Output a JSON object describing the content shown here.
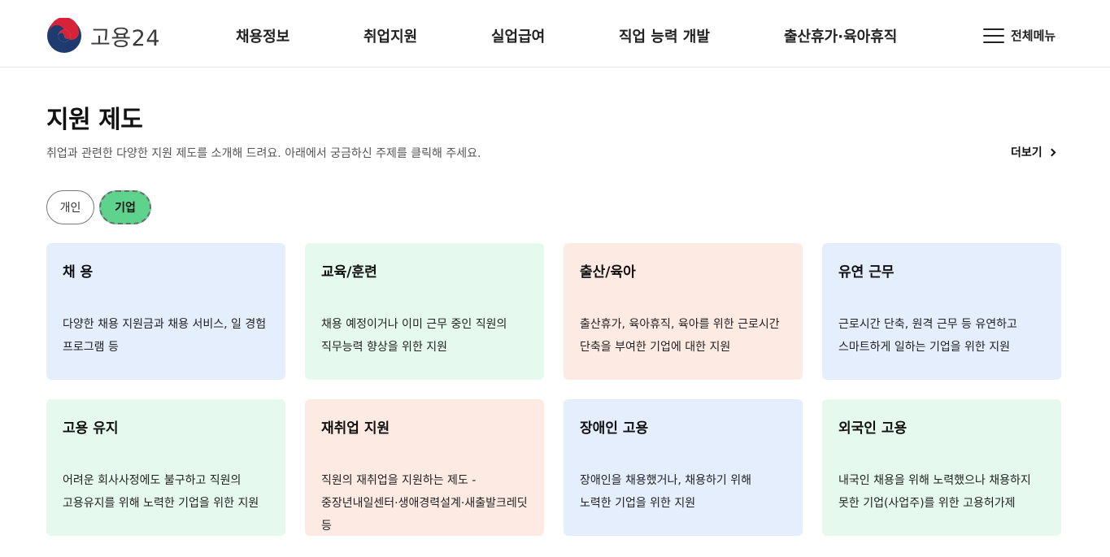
{
  "header": {
    "logo_text": "고용24",
    "nav": [
      "채용정보",
      "취업지원",
      "실업급여",
      "직업 능력 개발",
      "출산휴가·육아휴직"
    ],
    "all_menu_label": "전체메뉴"
  },
  "section": {
    "title": "지원 제도",
    "description": "취업과 관련한 다양한 지원 제도를 소개해 드려요. 아래에서 궁금하신 주제를 클릭해 주세요.",
    "more_label": "더보기"
  },
  "tabs": [
    {
      "label": "개인",
      "selected": false
    },
    {
      "label": "기업",
      "selected": true
    }
  ],
  "colors": {
    "card_blue": "#e4eefd",
    "card_green": "#e5f9ee",
    "card_peach": "#fdebe3",
    "tab_selected": "#5fd38e",
    "logo_blue": "#1e3a6e",
    "logo_red": "#d6233a"
  },
  "cards": [
    {
      "title": "채 용",
      "desc": "다양한 채용 지원금과 채용 서비스, 일 경험 프로그램 등",
      "color": "blue"
    },
    {
      "title": "교육/훈련",
      "desc": "채용 예정이거나 이미 근무 중인 직원의 직무능력 향상을 위한 지원",
      "color": "green"
    },
    {
      "title": "출산/육아",
      "desc": "출산휴가, 육아휴직, 육아를 위한 근로시간 단축을 부여한 기업에 대한 지원",
      "color": "peach"
    },
    {
      "title": "유연 근무",
      "desc": "근로시간 단축, 원격 근무 등 유연하고 스마트하게 일하는 기업을 위한 지원",
      "color": "blue"
    },
    {
      "title": "고용 유지",
      "desc": "어려운 회사사정에도 불구하고 직원의 고용유지를 위해 노력한 기업을 위한 지원",
      "color": "green"
    },
    {
      "title": "재취업 지원",
      "desc": "직원의 재취업을 지원하는 제도 - 중장년내일센터·생애경력설계·새출발크레딧 등",
      "color": "peach"
    },
    {
      "title": "장애인 고용",
      "desc": "장애인을 채용했거나, 채용하기 위해 노력한 기업을 위한 지원",
      "color": "blue"
    },
    {
      "title": "외국인 고용",
      "desc": "내국인 채용을 위해 노력했으나 채용하지 못한 기업(사업주)를 위한 고용허가제",
      "color": "green"
    }
  ]
}
